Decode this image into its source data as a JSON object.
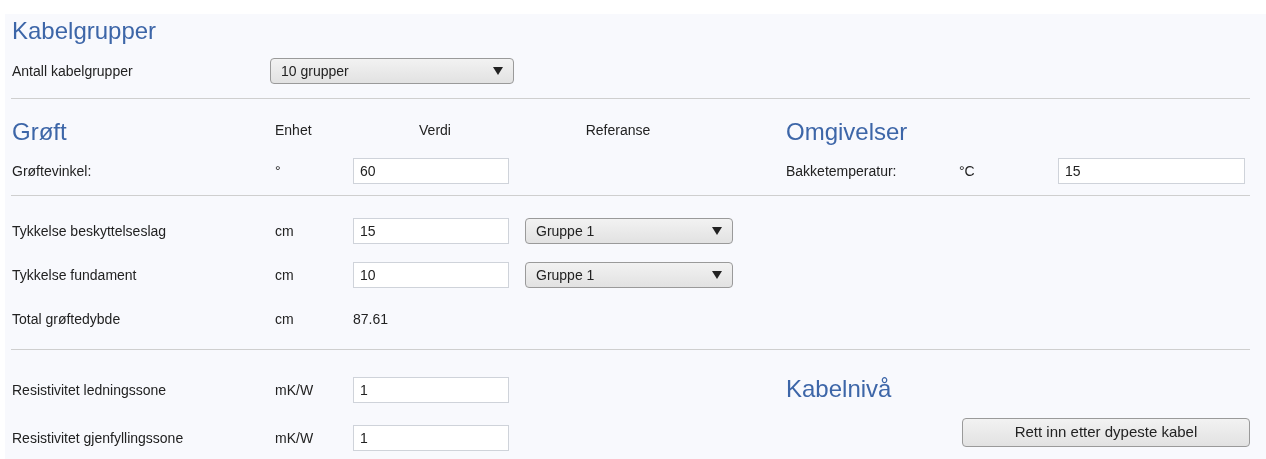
{
  "title": "Kabelgrupper",
  "group_count": {
    "label": "Antall kabelgrupper",
    "value": "10 grupper"
  },
  "trench": {
    "title": "Grøft",
    "columns": [
      "Enhet",
      "Verdi",
      "Referanse"
    ],
    "angle": {
      "label": "Grøftevinkel:",
      "unit": "°",
      "value": "60"
    },
    "rows": [
      {
        "kind": "input_ref",
        "label": "Tykkelse beskyttelseslag",
        "unit": "cm",
        "value": "15",
        "reference": "Gruppe 1"
      },
      {
        "kind": "input_ref",
        "label": "Tykkelse fundament",
        "unit": "cm",
        "value": "10",
        "reference": "Gruppe 1"
      },
      {
        "kind": "readout",
        "label": "Total grøftedybde",
        "unit": "cm",
        "value": "87.61"
      }
    ],
    "resistivity": [
      {
        "label": "Resistivitet ledningssone",
        "unit": "mK/W",
        "value": "1"
      },
      {
        "label": "Resistivitet gjenfyllingssone",
        "unit": "mK/W",
        "value": "1"
      }
    ]
  },
  "surroundings": {
    "title": "Omgivelser",
    "label": "Bakketemperatur:",
    "unit": "°C",
    "value": "15"
  },
  "cable_level": {
    "title": "Kabelnivå",
    "button": "Rett inn etter dypeste kabel"
  }
}
